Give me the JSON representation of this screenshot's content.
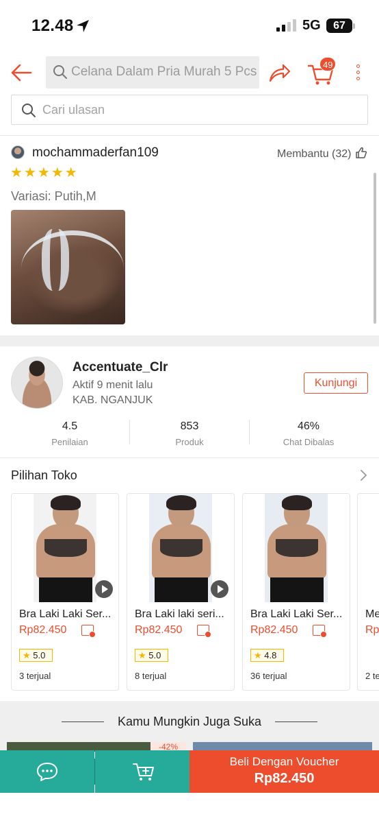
{
  "status_bar": {
    "time": "12.48",
    "network": "5G",
    "battery": "67"
  },
  "header": {
    "search_placeholder": "Celana Dalam Pria Murah 5 Pcs",
    "cart_count": "49",
    "accent_color": "#ee4d2d"
  },
  "review_search": {
    "placeholder": "Cari ulasan"
  },
  "review": {
    "username": "mochammaderfan109",
    "helpful_label": "Membantu (32)",
    "rating_stars": 5,
    "variant": "Variasi: Putih,M"
  },
  "shop": {
    "name": "Accentuate_Clr",
    "active": "Aktif 9 menit lalu",
    "location": "KAB. NGANJUK",
    "visit_label": "Kunjungi",
    "stats": [
      {
        "value": "4.5",
        "label": "Penilaian"
      },
      {
        "value": "853",
        "label": "Produk"
      },
      {
        "value": "46%",
        "label": "Chat Dibalas"
      }
    ]
  },
  "picks": {
    "heading": "Pilihan Toko",
    "items": [
      {
        "title": "Bra Laki Laki Ser...",
        "price": "Rp82.450",
        "rating": "5.0",
        "sold": "3 terjual"
      },
      {
        "title": "Bra Laki laki seri...",
        "price": "Rp82.450",
        "rating": "5.0",
        "sold": "8 terjual"
      },
      {
        "title": "Bra Laki Laki Ser...",
        "price": "Rp82.450",
        "rating": "4.8",
        "sold": "36 terjual"
      },
      {
        "title": "Me",
        "price": "Rp",
        "rating": "",
        "sold": "2 te"
      }
    ]
  },
  "also_like": {
    "heading": "Kamu Mungkin Juga Suka",
    "partial_badge": "-42%"
  },
  "bottom_bar": {
    "buy_label": "Beli Dengan Voucher",
    "buy_price": "Rp82.450",
    "chat_color": "#26aa99",
    "buy_color": "#ee4d2d"
  }
}
